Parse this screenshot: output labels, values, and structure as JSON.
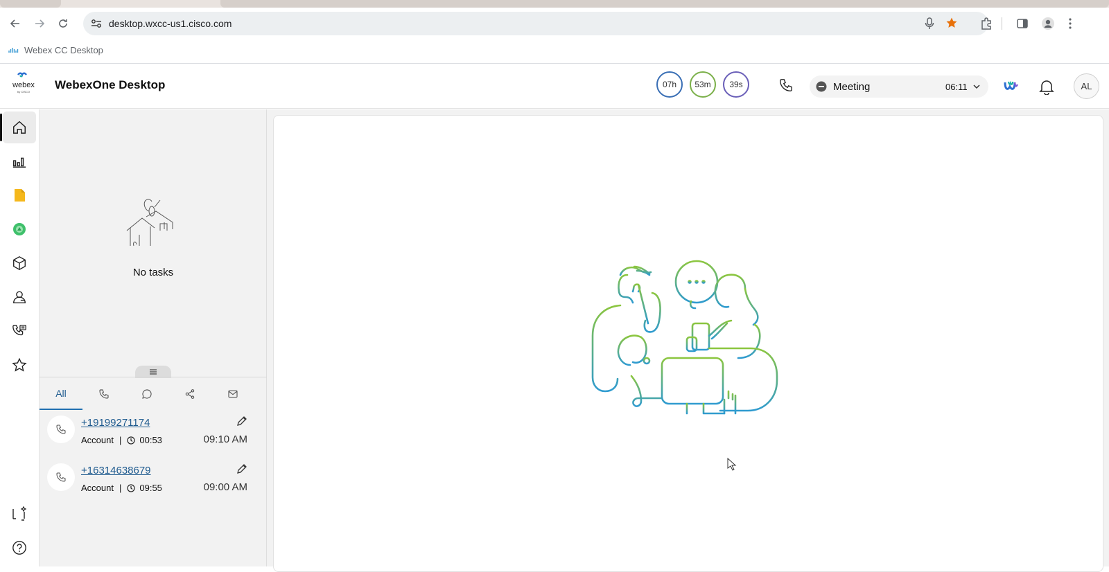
{
  "browser": {
    "url": "desktop.wxcc-us1.cisco.com",
    "bookmark_label": "Webex CC Desktop"
  },
  "header": {
    "app_title": "WebexOne Desktop",
    "timers": {
      "hours": "07h",
      "minutes": "53m",
      "seconds": "39s"
    },
    "agent_state": {
      "label": "Meeting",
      "elapsed": "06:11"
    },
    "avatar_initials": "AL"
  },
  "left_nav": {
    "items": [
      "home",
      "analytics",
      "notes",
      "widget",
      "package",
      "user",
      "phone-list",
      "favorites",
      "help"
    ],
    "active": "home"
  },
  "task_panel": {
    "empty_message": "No tasks",
    "filter_tabs": [
      {
        "label": "All",
        "icon": "",
        "active": true
      },
      {
        "label": "",
        "icon": "phone-icon"
      },
      {
        "label": "",
        "icon": "chat-icon"
      },
      {
        "label": "",
        "icon": "share-icon"
      },
      {
        "label": "",
        "icon": "mail-icon"
      }
    ],
    "tasks": [
      {
        "number": "+19199271174",
        "type": "Account",
        "duration": "00:53",
        "time": "09:10 AM"
      },
      {
        "number": "+16314638679",
        "type": "Account",
        "duration": "09:55",
        "time": "09:00 AM"
      }
    ]
  },
  "colors": {
    "accent": "#1f6fb0",
    "timer_hours": "#3a6fb5",
    "timer_minutes": "#7bb04a",
    "timer_seconds": "#6a5fb8",
    "illustration_green": "#7cbf4e",
    "illustration_blue": "#3aa0c8"
  }
}
